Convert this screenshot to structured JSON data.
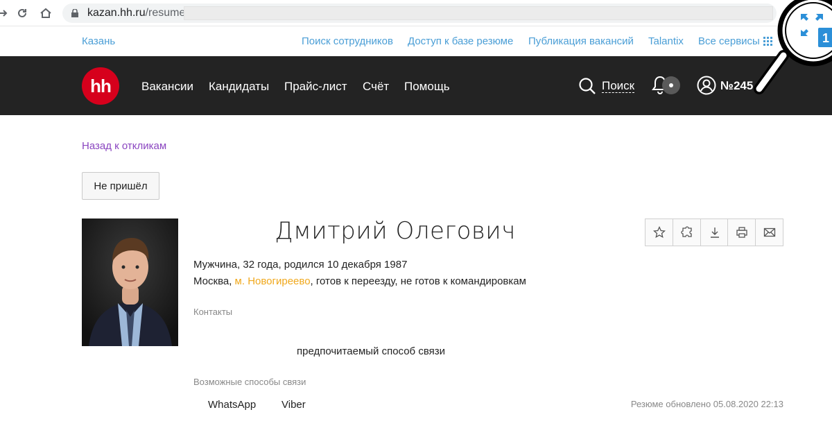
{
  "browser": {
    "url_host": "kazan.hh.ru",
    "url_path": "/resume/"
  },
  "topbar": {
    "city": "Казань",
    "links": [
      "Поиск сотрудников",
      "Доступ к базе резюме",
      "Публикация вакансий",
      "Talantix",
      "Все сервисы"
    ]
  },
  "header": {
    "logo_text": "hh",
    "nav": [
      "Вакансии",
      "Кандидаты",
      "Прайс-лист",
      "Счёт",
      "Помощь"
    ],
    "search_label": "Поиск",
    "account_label": "№245"
  },
  "page": {
    "back_link": "Назад к откликам",
    "status_button": "Не пришёл",
    "candidate_name": "Дмитрий Олегович",
    "info_line1": "Мужчина, 32 года, родился 10 декабря 1987",
    "city": "Москва, ",
    "metro": "м. Новогиреево",
    "relocation": ", готов к переезду, не готов к командировкам",
    "contacts_label": "Контакты",
    "preferred_label": "предпочитаемый способ связи",
    "methods_label": "Возможные способы связи",
    "methods": [
      "WhatsApp",
      "Viber"
    ],
    "updated": "Резюме обновлено 05.08.2020 22:13"
  },
  "colors": {
    "brand_red": "#d6001c",
    "header_bg": "#232323",
    "link_blue": "#4a9ed6",
    "back_purple": "#8a45c0",
    "metro_orange": "#f0a81c"
  },
  "actions": [
    "star-icon",
    "puzzle-icon",
    "download-icon",
    "print-icon",
    "mail-icon"
  ]
}
